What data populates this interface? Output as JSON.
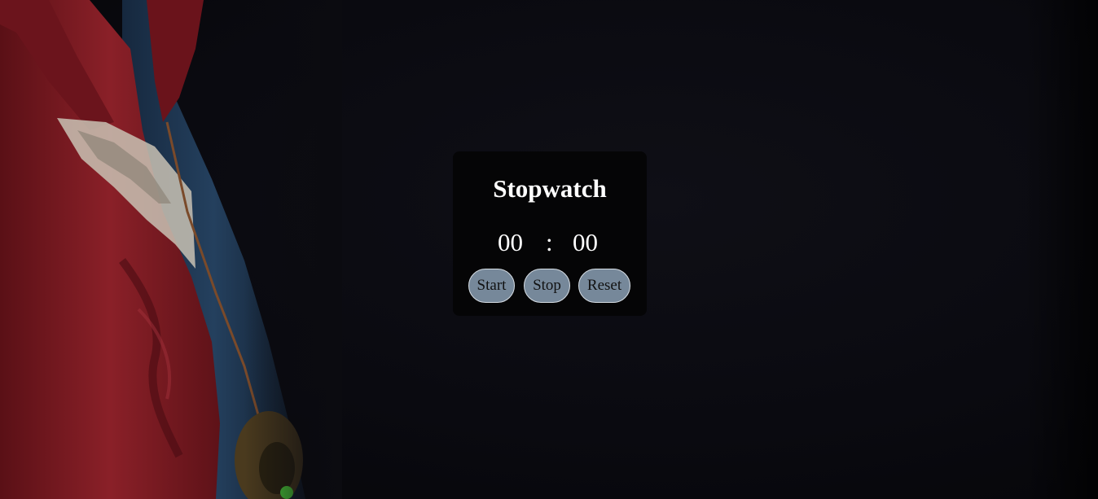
{
  "stopwatch": {
    "title": "Stopwatch",
    "minutes": "00",
    "separator": ":",
    "seconds": "00",
    "buttons": {
      "start": "Start",
      "stop": "Stop",
      "reset": "Reset"
    }
  },
  "colors": {
    "background": "#0b0b10",
    "panel": "#050506",
    "button_fill": "#76889a",
    "button_border": "#d6dde4",
    "text": "#ffffff",
    "cloak_red": "#7a1a22",
    "robe_blue": "#1e3550"
  }
}
